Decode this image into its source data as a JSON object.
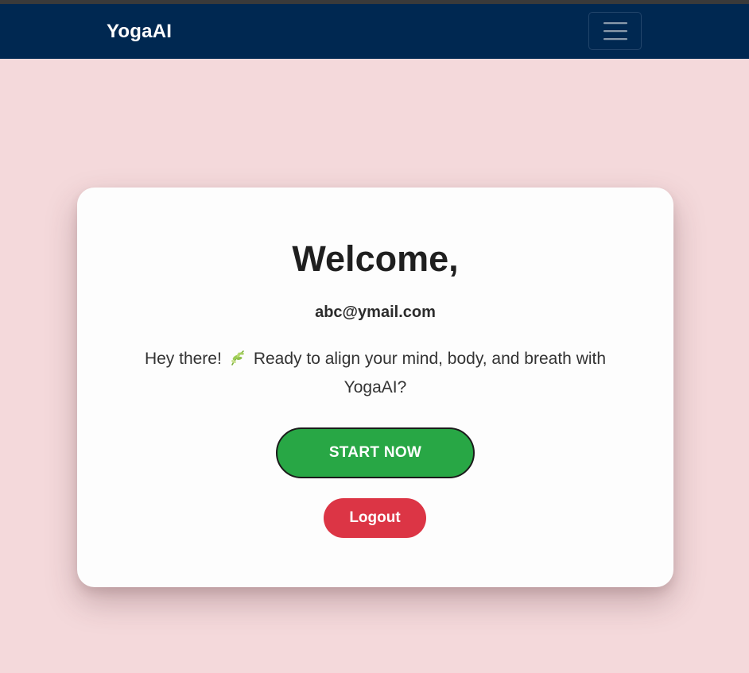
{
  "navbar": {
    "brand": "YogaAI",
    "toggle_icon": "hamburger-menu-icon",
    "background": "#002851"
  },
  "card": {
    "title": "Welcome,",
    "email": "abc@ymail.com",
    "message_before_icon": "Hey there!",
    "message_icon": "herb-leaf-icon",
    "message_after_icon": "Ready to align your mind, body, and breath with YogaAI?",
    "start_label": "START NOW",
    "logout_label": "Logout"
  },
  "colors": {
    "page_background": "#f4d9db",
    "start_button": "#28a745",
    "logout_button": "#dc3545"
  }
}
